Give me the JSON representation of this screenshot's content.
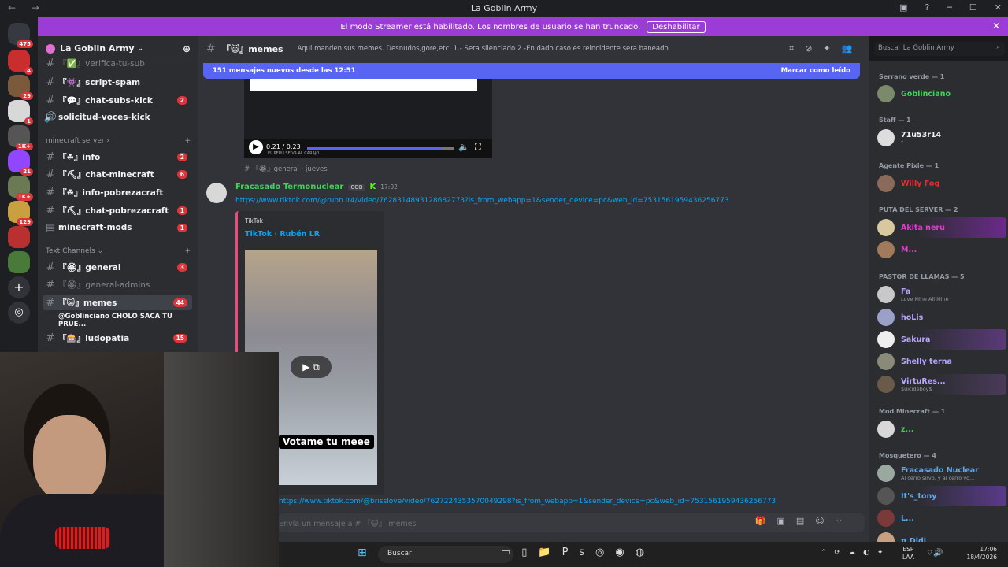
{
  "window": {
    "title": "La Goblin Army",
    "nav": "← →"
  },
  "banner": {
    "text": "El modo Streamer está habilitado. Los nombres de usuario se han truncado.",
    "button": "Deshabilitar"
  },
  "servers": {
    "badges": [
      "475",
      "4",
      "29",
      "1",
      "1K+",
      "21",
      "1K+",
      "129"
    ]
  },
  "guild": {
    "name": "La Goblin Army"
  },
  "sidebar": {
    "channels_top": [
      {
        "label": "『✅』verifica-tu-sub",
        "dim": true
      },
      {
        "label": "『👾』script-spam"
      },
      {
        "label": "『💬』chat-subs-kick",
        "badge": "2"
      },
      {
        "label": "solicitud-voces-kick"
      }
    ],
    "cat_minecraft": "minecraft server",
    "channels_mc": [
      {
        "label": "『☘』info",
        "badge": "2"
      },
      {
        "label": "『⛏』chat-minecraft",
        "badge": "6"
      },
      {
        "label": "『☘』info-pobrezacraft"
      },
      {
        "label": "『⛏』chat-pobrezacraft",
        "badge": "1"
      },
      {
        "label": "minecraft-mods",
        "badge": "1"
      }
    ],
    "cat_text": "Text Channels",
    "channels_text": [
      {
        "label": "『🏵』general",
        "badge": "3"
      },
      {
        "label": "『🏵』general-admins",
        "dim": true
      },
      {
        "label": "『😺』memes",
        "badge": "44"
      },
      {
        "label": "@Goblinciano CHOLO SACA TU PRUE..."
      },
      {
        "label": "『🎰』ludopatia",
        "badge": "15"
      }
    ]
  },
  "channel": {
    "name": "『😺』memes",
    "topic": "Aqui manden sus memes. Desnudos,gore,etc. 1.- Sera silenciado 2.-En dado caso es reincidente sera baneado"
  },
  "newbar": {
    "text": "151 mensajes nuevos desde las 12:51",
    "action": "Marcar como leído"
  },
  "video_prev": {
    "time": "0:21 / 0:23",
    "caption": "EL PERU SE VA AL CARAJO",
    "thread": "# 『🏵』general · jueves"
  },
  "message": {
    "author": "Fracasado Termonuclear",
    "tag": "COB",
    "time": "17:02",
    "link": "https://www.tiktok.com/@rubn.lr4/video/7628314893128682773?is_from_webapp=1&sender_device=pc&web_id=7531561959436256773",
    "embed_provider": "TikTok",
    "embed_title": "TikTok · Rubén LR",
    "video_caption": "Votame tu meee",
    "link2": "https://www.tiktok.com/@brisslove/video/7627224353570049298?is_from_webapp=1&sender_device=pc&web_id=7531561959436256773"
  },
  "input": {
    "placeholder": "Envía un mensaje a # 『😺』 memes"
  },
  "search": {
    "placeholder": "Buscar La Goblin Army"
  },
  "members": [
    {
      "cat": "Serrano verde — 1",
      "names": [
        {
          "n": "Goblinciano",
          "c": "#43d15a"
        }
      ]
    },
    {
      "cat": "Staff — 1",
      "names": [
        {
          "n": "71u53r14",
          "c": "#f2f3f5",
          "s": "†"
        }
      ]
    },
    {
      "cat": "Agente Pixie — 1",
      "names": [
        {
          "n": "Willy Fog",
          "c": "#e0302f"
        }
      ]
    },
    {
      "cat": "PUTA DEL SERVER — 2",
      "names": [
        {
          "n": "Akita neru",
          "c": "#e43bd1"
        },
        {
          "n": "M...",
          "c": "#e43bd1"
        }
      ]
    },
    {
      "cat": "PASTOR DE LLAMAS — 5",
      "names": [
        {
          "n": "Fa",
          "c": "#b9a4ff",
          "s": "Love Mine All Mine"
        },
        {
          "n": "hoLis",
          "c": "#b9a4ff"
        },
        {
          "n": "Sakura",
          "c": "#b9a4ff"
        },
        {
          "n": "Shelly terna",
          "c": "#b9a4ff"
        },
        {
          "n": "VirtuRes...",
          "c": "#b9a4ff",
          "s": "$uicideboy$"
        }
      ]
    },
    {
      "cat": "Mod Minecraft — 1",
      "names": [
        {
          "n": "z...",
          "c": "#43d15a"
        }
      ]
    },
    {
      "cat": "Mosquetero — 4",
      "names": [
        {
          "n": "Fracasado Nuclear",
          "c": "#5aa9f5",
          "s": "Al cerro sirvo, y al cerro vo..."
        },
        {
          "n": "It's_tony",
          "c": "#5aa9f5"
        },
        {
          "n": "L...",
          "c": "#5aa9f5"
        },
        {
          "n": "π Didi",
          "c": "#5aa9f5"
        }
      ]
    }
  ],
  "taskbar": {
    "search": "Buscar",
    "lang1": "ESP",
    "lang2": "LAA",
    "time": "17:06",
    "date": "18/4/2026"
  }
}
